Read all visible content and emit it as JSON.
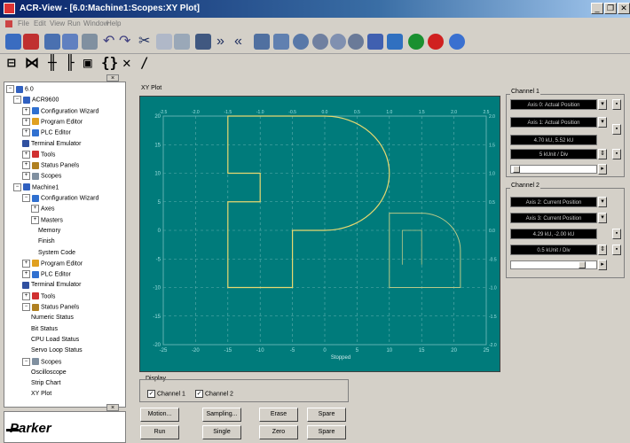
{
  "window": {
    "title": "ACR-View - [6.0:Machine1:Scopes:XY Plot]",
    "min": "_",
    "restore": "❐",
    "close": "✕"
  },
  "menu": [
    "File",
    "Edit",
    "View",
    "Run",
    "Window",
    "Help"
  ],
  "tree": [
    {
      "label": "6.0",
      "color": "#3060c0",
      "exp": "−"
    },
    {
      "label": "ACR9600",
      "color": "#3060c0",
      "exp": "−"
    },
    {
      "label": "Configuration Wizard",
      "color": "#3070d0",
      "exp": "+"
    },
    {
      "label": "Program Editor",
      "color": "#e0a020",
      "exp": "+"
    },
    {
      "label": "PLC Editor",
      "color": "#3070d0",
      "exp": "+"
    },
    {
      "label": "Terminal Emulator",
      "color": "#3050a0",
      "exp": ""
    },
    {
      "label": "Tools",
      "color": "#d03030",
      "exp": "+"
    },
    {
      "label": "Status Panels",
      "color": "#b08020",
      "exp": "+"
    },
    {
      "label": "Scopes",
      "color": "#8090a0",
      "exp": "+"
    },
    {
      "label": "Machine1",
      "color": "#3060c0",
      "exp": "−"
    },
    {
      "label": "Configuration Wizard",
      "color": "#3070d0",
      "exp": "−"
    },
    {
      "label": "Axes",
      "color": "",
      "exp": "+"
    },
    {
      "label": "Masters",
      "color": "",
      "exp": "+"
    },
    {
      "label": "Memory",
      "color": "",
      "exp": ""
    },
    {
      "label": "Finish",
      "color": "",
      "exp": ""
    },
    {
      "label": "System Code",
      "color": "",
      "exp": ""
    },
    {
      "label": "Program Editor",
      "color": "#e0a020",
      "exp": "+"
    },
    {
      "label": "PLC Editor",
      "color": "#3070d0",
      "exp": "+"
    },
    {
      "label": "Terminal Emulator",
      "color": "#3050a0",
      "exp": ""
    },
    {
      "label": "Tools",
      "color": "#d03030",
      "exp": "+"
    },
    {
      "label": "Status Panels",
      "color": "#b08020",
      "exp": "−"
    },
    {
      "label": "Numeric Status",
      "color": "",
      "exp": ""
    },
    {
      "label": "Bit Status",
      "color": "",
      "exp": ""
    },
    {
      "label": "CPU Load Status",
      "color": "",
      "exp": ""
    },
    {
      "label": "Servo Loop Status",
      "color": "",
      "exp": ""
    },
    {
      "label": "Scopes",
      "color": "#8090a0",
      "exp": "−"
    },
    {
      "label": "Oscilloscope",
      "color": "",
      "exp": ""
    },
    {
      "label": "Strip Chart",
      "color": "",
      "exp": ""
    },
    {
      "label": "XY Plot",
      "color": "",
      "exp": ""
    }
  ],
  "logo": "Parker",
  "plot": {
    "label": "XY Plot",
    "status": "Stopped",
    "x_ticks": [
      "-25",
      "-20",
      "-15",
      "-10",
      "-5",
      "0",
      "5",
      "10",
      "15",
      "20",
      "25"
    ],
    "y_ticks": [
      "20",
      "15",
      "10",
      "5",
      "0",
      "-5",
      "-10",
      "-15",
      "-20"
    ],
    "top_ticks": [
      "-2.5",
      "-2.0",
      "-1.5",
      "-1.0",
      "-0.5",
      "0.0",
      "0.5",
      "1.0",
      "1.5",
      "2.0",
      "2.5"
    ],
    "right_ticks": [
      "2.0",
      "1.5",
      "1.0",
      "0.5",
      "0.0",
      "-0.5",
      "-1.0",
      "-1.5",
      "-2.0"
    ],
    "grid_color": "#5fb0b0",
    "trace_color": "#e8d870"
  },
  "channel1": {
    "label": "Channel 1",
    "x_source": "Axis 0: Actual Position",
    "y_source": "Axis 1: Actual Position",
    "readout": "4.70 kU, 5.52 kU",
    "scale": "5 kUnit / Div"
  },
  "channel2": {
    "label": "Channel 2",
    "x_source": "Axis 2: Current Position",
    "y_source": "Axis 3: Current Position",
    "readout": "4.29 kU, -2.00 kU",
    "scale": "0.5 kUnit / Div"
  },
  "display": {
    "label": "Display",
    "ch1": "Channel 1",
    "ch2": "Channel 2"
  },
  "buttons": {
    "motion": "Motion...",
    "sampling": "Sampling...",
    "erase": "Erase",
    "spare1": "Spare",
    "run": "Run",
    "single": "Single",
    "zero": "Zero",
    "spare2": "Spare"
  },
  "toolbar_icons": [
    "open-icon",
    "connect-icon",
    "save-icon",
    "save-all-icon",
    "print-icon",
    "undo-icon",
    "redo-icon",
    "cut-icon",
    "copy-icon",
    "paste-icon",
    "jog-icon",
    "forward-icon",
    "rewind-icon",
    "download-icon",
    "upload-icon",
    "program-icon",
    "stop-program-icon",
    "reset-icon",
    "kill-icon",
    "download-os-icon",
    "upload-os-icon",
    "run-icon",
    "stop-icon",
    "help-icon"
  ]
}
